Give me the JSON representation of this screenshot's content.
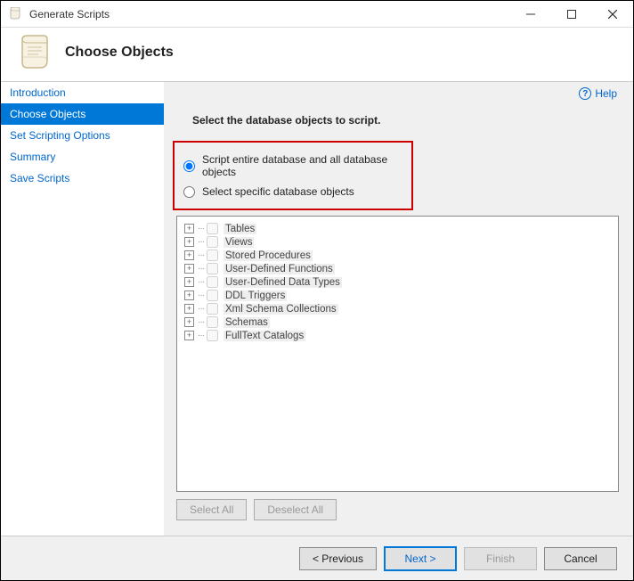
{
  "window": {
    "title": "Generate Scripts"
  },
  "header": {
    "title": "Choose Objects"
  },
  "help": {
    "label": "Help"
  },
  "sidebar": {
    "items": [
      {
        "label": "Introduction",
        "active": false
      },
      {
        "label": "Choose Objects",
        "active": true
      },
      {
        "label": "Set Scripting Options",
        "active": false
      },
      {
        "label": "Summary",
        "active": false
      },
      {
        "label": "Save Scripts",
        "active": false
      }
    ]
  },
  "main": {
    "instruction": "Select the database objects to script.",
    "radios": [
      {
        "label": "Script entire database and all database objects",
        "checked": true
      },
      {
        "label": "Select specific database objects",
        "checked": false
      }
    ],
    "tree": [
      {
        "label": "Tables"
      },
      {
        "label": "Views"
      },
      {
        "label": "Stored Procedures"
      },
      {
        "label": "User-Defined Functions"
      },
      {
        "label": "User-Defined Data Types"
      },
      {
        "label": "DDL Triggers"
      },
      {
        "label": "Xml Schema Collections"
      },
      {
        "label": "Schemas"
      },
      {
        "label": "FullText Catalogs"
      }
    ],
    "selectAll": "Select All",
    "deselectAll": "Deselect All"
  },
  "footer": {
    "previous": "< Previous",
    "next": "Next >",
    "finish": "Finish",
    "cancel": "Cancel"
  }
}
